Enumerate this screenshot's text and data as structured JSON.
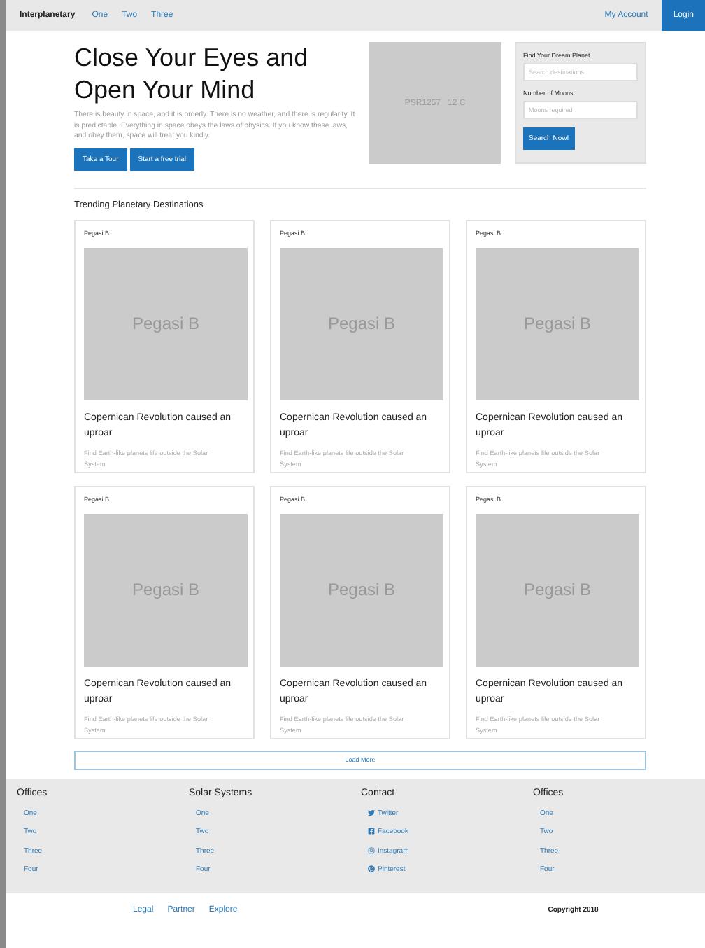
{
  "navbar": {
    "brand": "Interplanetary",
    "links": [
      "One",
      "Two",
      "Three"
    ],
    "account": "My Account",
    "login": "Login"
  },
  "hero": {
    "title": [
      "Close Your Eyes and",
      "Open Your Mind"
    ],
    "text": "There is beauty in space, and it is orderly. There is no weather, and there is regularity. It is predictable. Everything in space obeys the laws of physics. If you know these laws, and obey them, space will treat you kindly.",
    "buttons": [
      "Take a Tour",
      "Start a free trial"
    ],
    "image_label": "PSR1257   12 C"
  },
  "search_panel": {
    "fields": [
      {
        "label": "Find Your Dream Planet",
        "placeholder": "Search destinations"
      },
      {
        "label": "Number of Moons",
        "placeholder": "Moons required"
      }
    ],
    "button": "Search Now!"
  },
  "section_title": "Trending Planetary Destinations",
  "cards": [
    {
      "name": "Pegasi B",
      "image_label": "Pegasi B",
      "title": "Copernican Revolution caused an uproar",
      "text": "Find Earth-like planets life outside the Solar System"
    },
    {
      "name": "Pegasi B",
      "image_label": "Pegasi B",
      "title": "Copernican Revolution caused an uproar",
      "text": "Find Earth-like planets life outside the Solar System"
    },
    {
      "name": "Pegasi B",
      "image_label": "Pegasi B",
      "title": "Copernican Revolution caused an uproar",
      "text": "Find Earth-like planets life outside the Solar System"
    },
    {
      "name": "Pegasi B",
      "image_label": "Pegasi B",
      "title": "Copernican Revolution caused an uproar",
      "text": "Find Earth-like planets life outside the Solar System"
    },
    {
      "name": "Pegasi B",
      "image_label": "Pegasi B",
      "title": "Copernican Revolution caused an uproar",
      "text": "Find Earth-like planets life outside the Solar System"
    },
    {
      "name": "Pegasi B",
      "image_label": "Pegasi B",
      "title": "Copernican Revolution caused an uproar",
      "text": "Find Earth-like planets life outside the Solar System"
    }
  ],
  "load_more": "Load More",
  "footer": {
    "columns": [
      {
        "title": "Offices",
        "links": [
          {
            "label": "One"
          },
          {
            "label": "Two"
          },
          {
            "label": "Three"
          },
          {
            "label": "Four"
          }
        ]
      },
      {
        "title": "Solar Systems",
        "links": [
          {
            "label": "One"
          },
          {
            "label": "Two"
          },
          {
            "label": "Three"
          },
          {
            "label": "Four"
          }
        ]
      },
      {
        "title": "Contact",
        "links": [
          {
            "label": "Twitter",
            "kind": "twitter"
          },
          {
            "label": "Facebook",
            "kind": "facebook"
          },
          {
            "label": "Instagram",
            "kind": "instagram"
          },
          {
            "label": "Pinterest",
            "kind": "pinterest"
          }
        ]
      },
      {
        "title": "Offices",
        "links": [
          {
            "label": "One"
          },
          {
            "label": "Two"
          },
          {
            "label": "Three"
          },
          {
            "label": "Four"
          }
        ]
      }
    ],
    "bottom_links": [
      "Legal",
      "Partner",
      "Explore"
    ],
    "copyright": "Copyright 2018"
  }
}
